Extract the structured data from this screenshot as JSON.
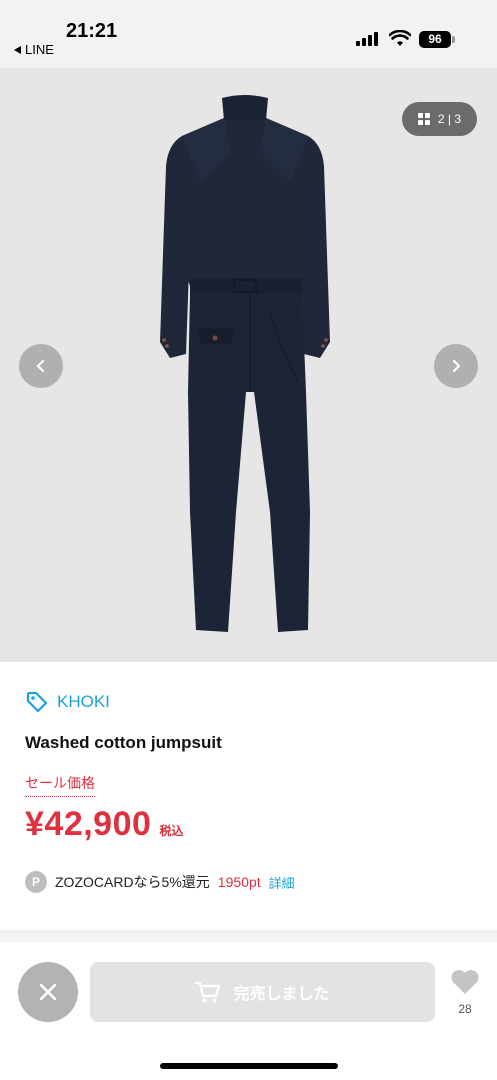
{
  "status_bar": {
    "time": "21:21",
    "back_app": "LINE",
    "battery": "96",
    "icons": [
      "signal-icon",
      "wifi-icon",
      "battery-icon"
    ]
  },
  "gallery": {
    "counter": "2 | 3",
    "icons": [
      "grid-icon",
      "chevron-left-icon",
      "chevron-right-icon"
    ]
  },
  "product": {
    "brand": "KHOKI",
    "name": "Washed cotton jumpsuit",
    "sale_label": "セール価格",
    "price": "¥42,900",
    "tax_label": "税込",
    "points_badge": "P",
    "points_text": "ZOZOCARDなら5%還元",
    "points_value": "1950pt",
    "details_link": "詳細"
  },
  "bottom_bar": {
    "soldout_label": "完売しました",
    "favorite_count": "28"
  },
  "colors": {
    "accent_blue": "#1aa4d8",
    "sale_red": "#e0313f",
    "image_bg": "#e6e6e6"
  }
}
